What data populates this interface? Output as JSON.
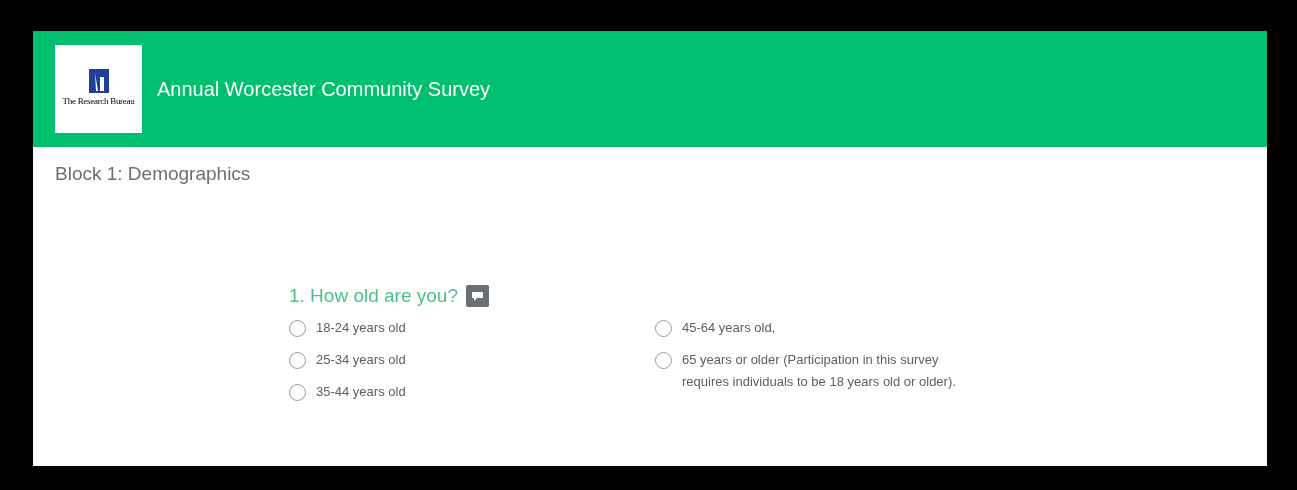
{
  "header": {
    "logo_text": "The Research Bureau",
    "title": "Annual Worcester Community Survey"
  },
  "block_title": "Block 1: Demographics",
  "question": {
    "title": "1. How old are you?",
    "options": [
      {
        "label": "18-24 years old",
        "selected": false
      },
      {
        "label": "25-34 years old",
        "selected": false
      },
      {
        "label": "35-44 years old",
        "selected": false
      },
      {
        "label": "45-64 years old,",
        "selected": false
      },
      {
        "label": "65 years or older (Participation in this survey requires individuals to be 18 years old or older).",
        "selected": false
      }
    ]
  }
}
